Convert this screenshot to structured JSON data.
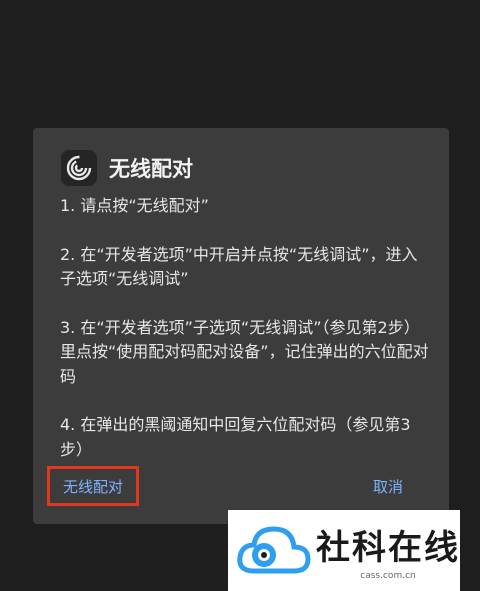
{
  "dialog": {
    "title": "无线配对",
    "icon": "swirl-logo-icon",
    "steps": [
      "1. 请点按“无线配对”",
      "2. 在“开发者选项”中开启并点按“无线调试”，进入子选项“无线调试”",
      "3. 在“开发者选项”子选项“无线调试”（参见第2步）里点按“使用配对码配对设备”，记住弹出的六位配对码",
      "4. 在弹出的黑阈通知中回复六位配对码（参见第3步）"
    ],
    "pair_button": "无线配对",
    "cancel_button": "取消"
  },
  "watermark": {
    "name": "社科在线",
    "url": "cass.com.cn"
  },
  "colors": {
    "accent": "#7db2ff",
    "highlight": "#e0371d",
    "dialog_bg": "#3c3c3c",
    "page_bg": "#1e1e1e"
  }
}
